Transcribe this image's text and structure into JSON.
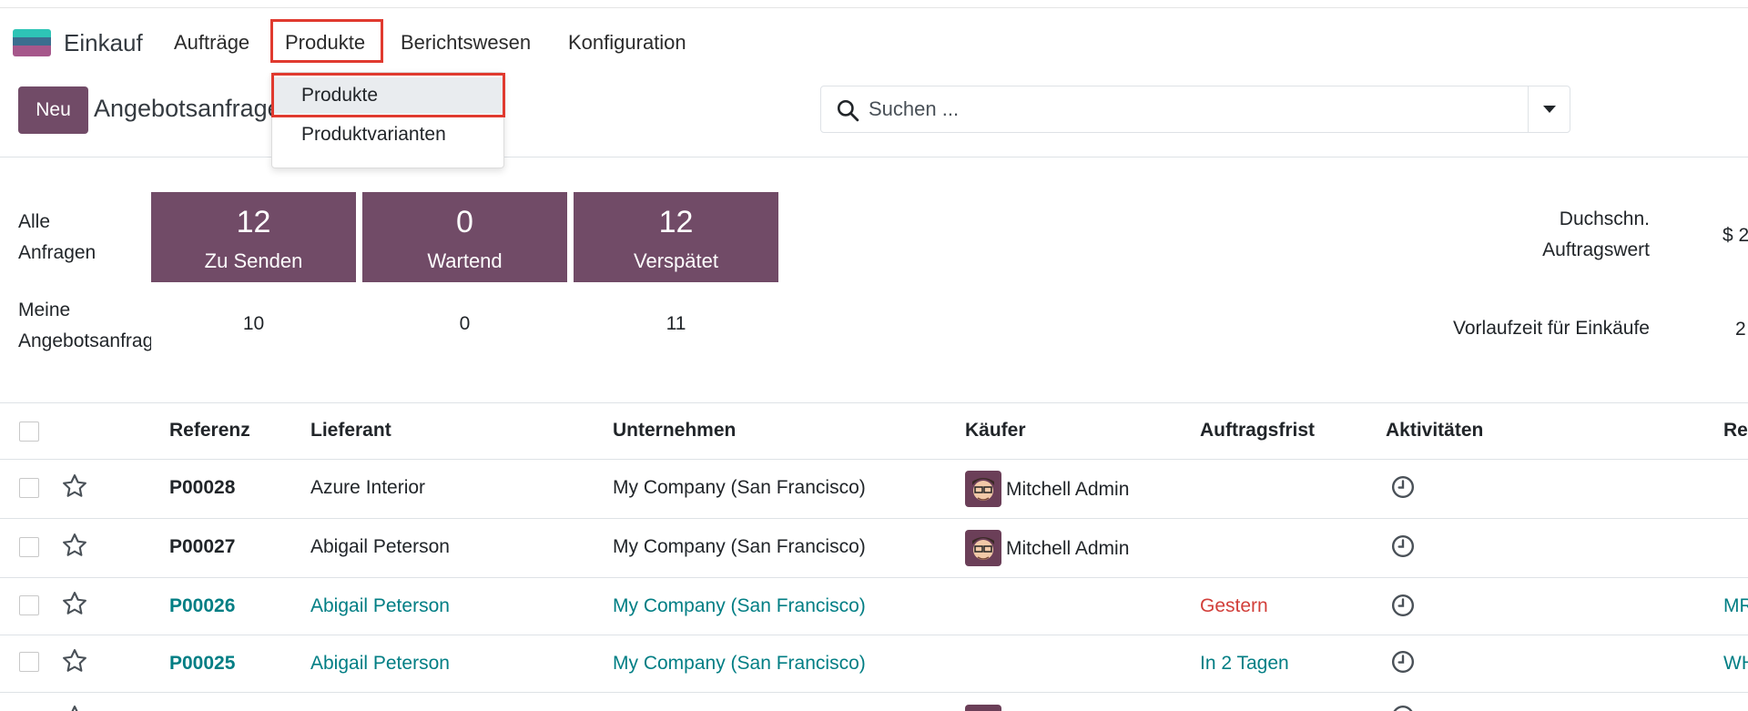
{
  "app": {
    "name": "Einkauf",
    "brand_colors": [
      "#2ec4b6",
      "#3b6e8f",
      "#a6578b"
    ]
  },
  "menu": {
    "items": [
      {
        "label": "Aufträge"
      },
      {
        "label": "Produkte",
        "active": true
      },
      {
        "label": "Berichtswesen"
      },
      {
        "label": "Konfiguration"
      }
    ]
  },
  "dropdown": {
    "items": [
      {
        "label": "Produkte",
        "highlighted": true
      },
      {
        "label": "Produktvarianten"
      }
    ]
  },
  "control_panel": {
    "new_button": "Neu",
    "breadcrumb": "Angebotsanfragen",
    "search_placeholder": "Suchen ..."
  },
  "dashboard": {
    "row1_label_line1": "Alle",
    "row1_label_line2": "Anfragen",
    "row2_label_line1": "Meine",
    "row2_label_line2": "Angebotsanfragen",
    "tiles": [
      {
        "count": "12",
        "label": "Zu Senden",
        "mine": "10"
      },
      {
        "count": "0",
        "label": "Wartend",
        "mine": "0"
      },
      {
        "count": "12",
        "label": "Verspätet",
        "mine": "11"
      }
    ],
    "kpi1_label_line1": "Duchschn.",
    "kpi1_label_line2": "Auftragswert",
    "kpi1_value": "$ 2",
    "kpi2_label": "Vorlaufzeit für Einkäufe",
    "kpi2_value": "2"
  },
  "table": {
    "headers": [
      "Referenz",
      "Lieferant",
      "Unternehmen",
      "Käufer",
      "Auftragsfrist",
      "Aktivitäten",
      "Re"
    ],
    "rows": [
      {
        "reference": "P00028",
        "vendor": "Azure Interior",
        "company": "My Company (San Francisco)",
        "buyer": "Mitchell Admin",
        "deadline": "",
        "source": "",
        "is_link": false
      },
      {
        "reference": "P00027",
        "vendor": "Abigail Peterson",
        "company": "My Company (San Francisco)",
        "buyer": "Mitchell Admin",
        "deadline": "",
        "source": "",
        "is_link": false
      },
      {
        "reference": "P00026",
        "vendor": "Abigail Peterson",
        "company": "My Company (San Francisco)",
        "buyer": "",
        "deadline": "Gestern",
        "deadline_status": "overdue",
        "source": "MR",
        "is_link": true
      },
      {
        "reference": "P00025",
        "vendor": "Abigail Peterson",
        "company": "My Company (San Francisco)",
        "buyer": "",
        "deadline": "In 2 Tagen",
        "deadline_status": "upcoming",
        "source": "WH",
        "is_link": true
      }
    ]
  },
  "colors": {
    "primary": "#714b67",
    "link": "#017e84",
    "danger": "#d23f3a",
    "highlight_box": "#e03a2f"
  }
}
